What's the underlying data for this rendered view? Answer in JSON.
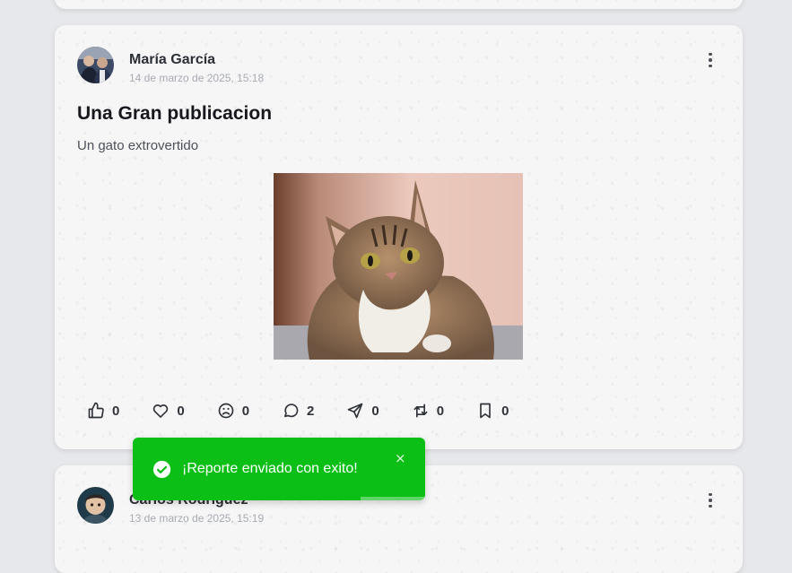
{
  "feed": {
    "posts": [
      {
        "author": "María García",
        "timestamp": "14 de marzo de 2025, 15:18",
        "title": "Una Gran publicacion",
        "body": "Un gato extrovertido",
        "image_alt": "tabby cat photo",
        "actions": [
          {
            "name": "like",
            "icon": "thumbs-up-icon",
            "count": "0"
          },
          {
            "name": "love",
            "icon": "heart-icon",
            "count": "0"
          },
          {
            "name": "sad",
            "icon": "sad-face-icon",
            "count": "0"
          },
          {
            "name": "comment",
            "icon": "comment-icon",
            "count": "2"
          },
          {
            "name": "share",
            "icon": "send-icon",
            "count": "0"
          },
          {
            "name": "repost",
            "icon": "repost-icon",
            "count": "0"
          },
          {
            "name": "save",
            "icon": "bookmark-icon",
            "count": "0"
          }
        ]
      },
      {
        "author": "Carlos Rodríguez",
        "timestamp": "13 de marzo de 2025, 15:19"
      }
    ]
  },
  "toast": {
    "message": "¡Reporte enviado con exito!",
    "close": "×",
    "icon": "check-circle-icon",
    "color": "#0bbf16"
  }
}
